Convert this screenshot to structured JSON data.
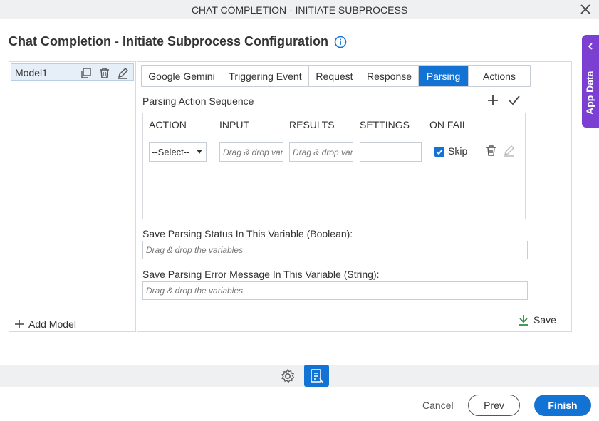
{
  "window": {
    "title": "CHAT COMPLETION - INITIATE SUBPROCESS"
  },
  "page": {
    "title": "Chat Completion - Initiate Subprocess Configuration"
  },
  "app_data_tab": {
    "label": "App Data"
  },
  "models": {
    "items": [
      {
        "label": "Model1"
      }
    ],
    "add_label": "Add Model"
  },
  "tabs": [
    {
      "label": "Google Gemini"
    },
    {
      "label": "Triggering Event"
    },
    {
      "label": "Request"
    },
    {
      "label": "Response"
    },
    {
      "label": "Parsing",
      "active": true
    },
    {
      "label": "Actions"
    }
  ],
  "parsing": {
    "section_title": "Parsing Action Sequence",
    "columns": [
      "ACTION",
      "INPUT",
      "RESULTS",
      "SETTINGS",
      "ON FAIL"
    ],
    "row": {
      "action": "--Select--",
      "input_placeholder": "Drag & drop variables",
      "results_placeholder": "Drag & drop variables",
      "settings": "",
      "on_fail_checked": true,
      "on_fail_label": "Skip"
    },
    "status_label": "Save Parsing Status In This Variable (Boolean):",
    "status_placeholder": "Drag & drop the variables",
    "error_label": "Save Parsing Error Message In This Variable (String):",
    "error_placeholder": "Drag & drop the variables",
    "save_label": "Save"
  },
  "footer": {
    "cancel": "Cancel",
    "prev": "Prev",
    "finish": "Finish"
  },
  "colors": {
    "accent": "#1273d4",
    "app_data": "#7b3fd2"
  }
}
